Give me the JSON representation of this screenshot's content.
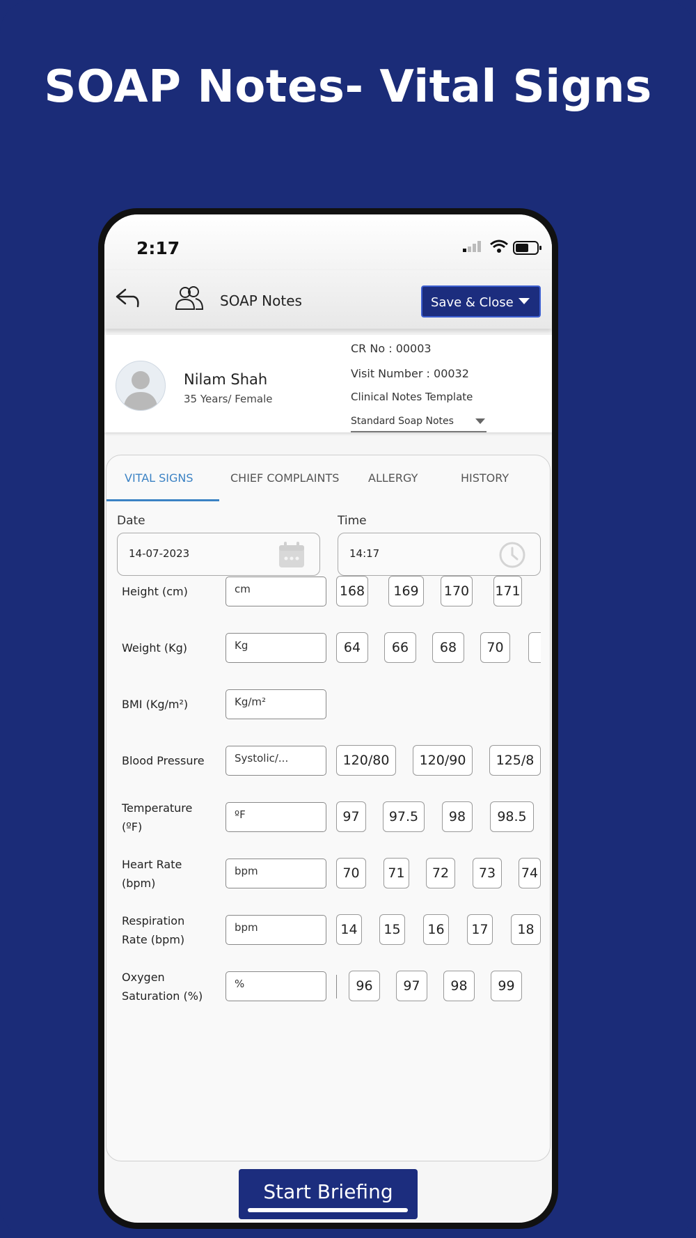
{
  "headline": "SOAP Notes- Vital Signs",
  "status_bar": {
    "time": "2:17"
  },
  "header": {
    "title": "SOAP Notes",
    "save_label": "Save & Close"
  },
  "patient": {
    "name": "Nilam Shah",
    "info": "35 Years/ Female",
    "cr_no": "CR No : 00003",
    "visit_number": "Visit Number : 00032",
    "template_label": "Clinical Notes Template",
    "template_value": "Standard Soap Notes"
  },
  "tabs": [
    "VITAL SIGNS",
    "CHIEF COMPLAINTS",
    "ALLERGY",
    "HISTORY"
  ],
  "datetime": {
    "date_label": "Date",
    "date_value": "14-07-2023",
    "time_label": "Time",
    "time_value": "14:17"
  },
  "vitals": [
    {
      "label": "Height (cm)",
      "placeholder": "cm",
      "chips": [
        "168",
        "169",
        "170",
        "171"
      ]
    },
    {
      "label": "Weight (Kg)",
      "placeholder": "Kg",
      "chips": [
        "64",
        "66",
        "68",
        "70",
        ""
      ]
    },
    {
      "label": "BMI (Kg/m²)",
      "placeholder": "Kg/m²",
      "chips": []
    },
    {
      "label": "Blood Pressure",
      "placeholder": "Systolic/...",
      "chips": [
        "120/80",
        "120/90",
        "125/8"
      ]
    },
    {
      "label": "Temperature (ºF)",
      "placeholder": "ºF",
      "chips": [
        "97",
        "97.5",
        "98",
        "98.5"
      ]
    },
    {
      "label": "Heart Rate (bpm)",
      "placeholder": "bpm",
      "chips": [
        "70",
        "71",
        "72",
        "73",
        "74"
      ]
    },
    {
      "label": "Respiration Rate (bpm)",
      "placeholder": "bpm",
      "chips": [
        "14",
        "15",
        "16",
        "17",
        "18"
      ]
    },
    {
      "label": "Oxygen Saturation (%)",
      "placeholder": "%",
      "chips": [
        "96",
        "97",
        "98",
        "99"
      ]
    }
  ],
  "footer": {
    "start_label": "Start Briefing"
  }
}
